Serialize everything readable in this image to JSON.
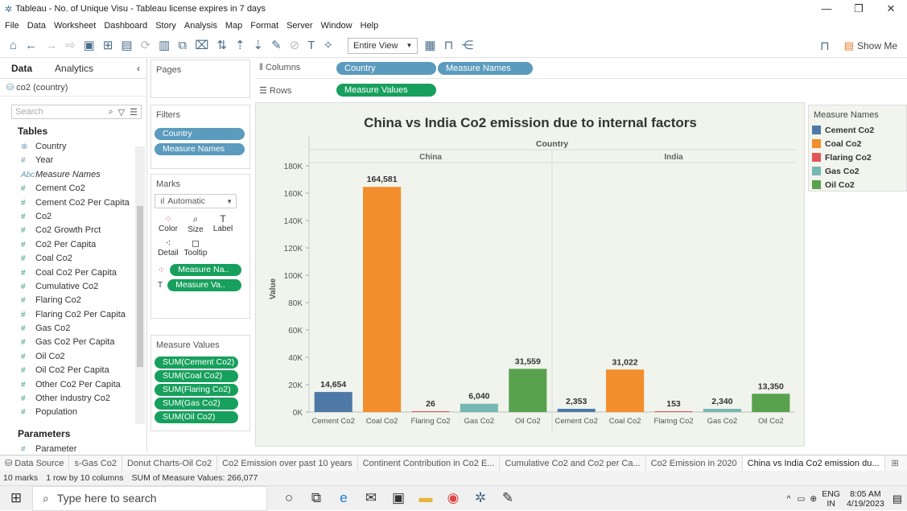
{
  "window": {
    "title": "Tableau - No. of Unique Visu - Tableau license expires in 7 days",
    "min": "—",
    "restore": "❐",
    "close": "✕"
  },
  "menu": [
    "File",
    "Data",
    "Worksheet",
    "Dashboard",
    "Story",
    "Analysis",
    "Map",
    "Format",
    "Server",
    "Window",
    "Help"
  ],
  "toolbar": {
    "view_select": "Entire View",
    "show_me": "Show Me"
  },
  "data_pane": {
    "tabs": [
      "Data",
      "Analytics"
    ],
    "datasource": "co2 (country)",
    "search_placeholder": "Search",
    "tables_header": "Tables",
    "fields": [
      {
        "icon": "⊕",
        "name": "Country",
        "type": "dim"
      },
      {
        "icon": "#",
        "name": "Year",
        "type": "dim"
      },
      {
        "icon": "Abc",
        "name": "Measure Names",
        "type": "dim",
        "italic": true
      },
      {
        "icon": "#",
        "name": "Cement Co2",
        "type": "meas"
      },
      {
        "icon": "#",
        "name": "Cement Co2 Per Capita",
        "type": "meas"
      },
      {
        "icon": "#",
        "name": "Co2",
        "type": "meas"
      },
      {
        "icon": "#",
        "name": "Co2 Growth Prct",
        "type": "meas"
      },
      {
        "icon": "#",
        "name": "Co2 Per Capita",
        "type": "meas"
      },
      {
        "icon": "#",
        "name": "Coal Co2",
        "type": "meas"
      },
      {
        "icon": "#",
        "name": "Coal Co2 Per Capita",
        "type": "meas"
      },
      {
        "icon": "#",
        "name": "Cumulative Co2",
        "type": "meas"
      },
      {
        "icon": "#",
        "name": "Flaring Co2",
        "type": "meas"
      },
      {
        "icon": "#",
        "name": "Flaring Co2 Per Capita",
        "type": "meas"
      },
      {
        "icon": "#",
        "name": "Gas Co2",
        "type": "meas"
      },
      {
        "icon": "#",
        "name": "Gas Co2 Per Capita",
        "type": "meas"
      },
      {
        "icon": "#",
        "name": "Oil Co2",
        "type": "meas"
      },
      {
        "icon": "#",
        "name": "Oil Co2 Per Capita",
        "type": "meas"
      },
      {
        "icon": "#",
        "name": "Other Co2 Per Capita",
        "type": "meas"
      },
      {
        "icon": "#",
        "name": "Other Industry Co2",
        "type": "meas"
      },
      {
        "icon": "#",
        "name": "Population",
        "type": "meas"
      }
    ],
    "parameters_header": "Parameters",
    "parameter": "Parameter"
  },
  "pages_label": "Pages",
  "filters": {
    "label": "Filters",
    "pills": [
      "Country",
      "Measure Names"
    ]
  },
  "marks": {
    "label": "Marks",
    "type": "Automatic",
    "buttons": [
      "Color",
      "Size",
      "Label",
      "Detail",
      "Tooltip"
    ],
    "pills": [
      "Measure Na..",
      "Measure Va.."
    ]
  },
  "measure_values": {
    "label": "Measure Values",
    "pills": [
      "SUM(Cement Co2)",
      "SUM(Coal Co2)",
      "SUM(Flaring Co2)",
      "SUM(Gas Co2)",
      "SUM(Oil Co2)"
    ]
  },
  "shelves": {
    "columns_label": "Columns",
    "columns": [
      "Country",
      "Measure Names"
    ],
    "rows_label": "Rows",
    "rows": [
      "Measure Values"
    ]
  },
  "legend": {
    "title": "Measure Names",
    "items": [
      {
        "name": "Cement Co2",
        "color": "#4e79a7"
      },
      {
        "name": "Coal Co2",
        "color": "#f28e2b"
      },
      {
        "name": "Flaring Co2",
        "color": "#e15759"
      },
      {
        "name": "Gas Co2",
        "color": "#76b7b2"
      },
      {
        "name": "Oil Co2",
        "color": "#59a14f"
      }
    ]
  },
  "chart_data": {
    "type": "bar",
    "title": "China vs India Co2 emission due to internal factors",
    "column_header": "Country",
    "ylabel": "Value",
    "ylim": [
      0,
      180000
    ],
    "yticks": [
      0,
      20000,
      40000,
      60000,
      80000,
      100000,
      120000,
      140000,
      160000,
      180000
    ],
    "ytick_labels": [
      "0K",
      "20K",
      "40K",
      "60K",
      "80K",
      "100K",
      "120K",
      "140K",
      "160K",
      "180K"
    ],
    "groups": [
      {
        "name": "China",
        "categories": [
          "Cement Co2",
          "Coal Co2",
          "Flaring Co2",
          "Gas Co2",
          "Oil Co2"
        ],
        "values": [
          14654,
          164581,
          26,
          6040,
          31559
        ],
        "labels": [
          "14,654",
          "164,581",
          "26",
          "6,040",
          "31,559"
        ]
      },
      {
        "name": "India",
        "categories": [
          "Cement Co2",
          "Coal Co2",
          "Flaring Co2",
          "Gas Co2",
          "Oil Co2"
        ],
        "values": [
          2353,
          31022,
          153,
          2340,
          13350
        ],
        "labels": [
          "2,353",
          "31,022",
          "153",
          "2,340",
          "13,350"
        ]
      }
    ]
  },
  "sheet_tabs": {
    "data_source": "Data Source",
    "tabs": [
      "s-Gas Co2",
      "Donut Charts-Oil Co2",
      "Co2 Emission over past 10 years",
      "Continent Contribution in Co2 E...",
      "Cumulative Co2 and Co2 per Ca...",
      "Co2 Emission in 2020",
      "China vs India Co2 emission du..."
    ]
  },
  "status": {
    "marks": "10 marks",
    "rows": "1 row by 10 columns",
    "sum": "SUM of Measure Values: 266,077"
  },
  "taskbar": {
    "search_placeholder": "Type here to search",
    "lang1": "ENG",
    "lang2": "IN",
    "time": "8:05 AM",
    "date": "4/19/2023"
  }
}
